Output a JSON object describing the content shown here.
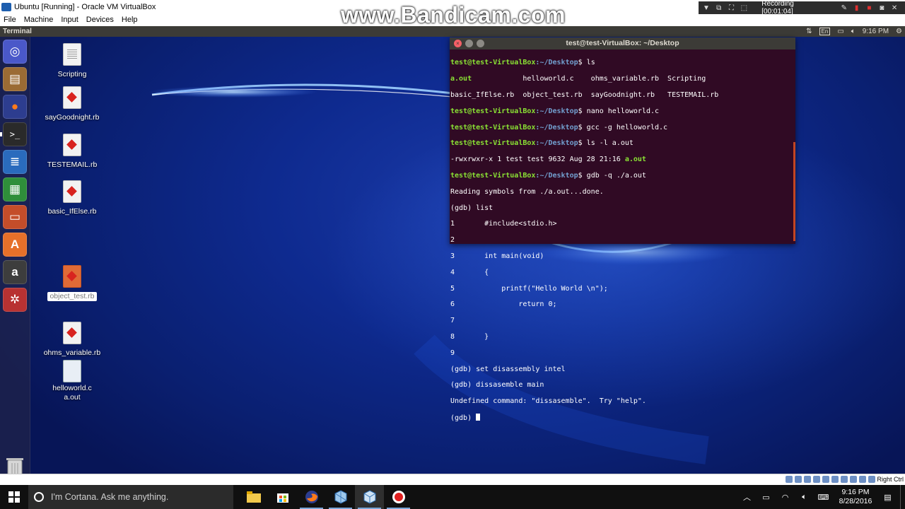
{
  "host": {
    "window_title": "Ubuntu [Running] - Oracle VM VirtualBox",
    "menu": [
      "File",
      "Machine",
      "Input",
      "Devices",
      "Help"
    ],
    "window_buttons": [
      "−",
      "☐",
      "✕"
    ],
    "status_right": "Right Ctrl"
  },
  "overlay": {
    "watermark": "www.Bandicam.com",
    "recording_label": "Recording [00:01:04]"
  },
  "ubuntu": {
    "topbar_app": "Terminal",
    "indicators": {
      "keyboard": "En",
      "time": "9:16 PM"
    },
    "launcher": [
      {
        "name": "ubuntu-dash",
        "glyph": "◎",
        "color": "#4b5bd1"
      },
      {
        "name": "files",
        "glyph": "▤",
        "color": "#b0793c"
      },
      {
        "name": "firefox",
        "glyph": "●",
        "color": "#e66000"
      },
      {
        "name": "terminal",
        "glyph": ">_",
        "color": "#2c2c2c"
      },
      {
        "name": "libreoffice-writer",
        "glyph": "≣",
        "color": "#2a6bbd"
      },
      {
        "name": "libreoffice-calc",
        "glyph": "▦",
        "color": "#2f8f3a"
      },
      {
        "name": "libreoffice-impress",
        "glyph": "▭",
        "color": "#c44d2a"
      },
      {
        "name": "software-center",
        "glyph": "A",
        "color": "#e6702a"
      },
      {
        "name": "amazon",
        "glyph": "a",
        "color": "#3d3d3d"
      },
      {
        "name": "system-settings",
        "glyph": "✲",
        "color": "#c93a3a"
      }
    ],
    "desktop_icons": [
      {
        "label": "Scripting",
        "kind": "doc"
      },
      {
        "label": "sayGoodnight.rb",
        "kind": "rb"
      },
      {
        "label": "TESTEMAIL.rb",
        "kind": "rb"
      },
      {
        "label": "basic_IfElse.rb",
        "kind": "rb"
      },
      {
        "label": "object_test.rb",
        "kind": "rb-selected"
      },
      {
        "label": "ohms_variable.rb",
        "kind": "rb"
      },
      {
        "label": "helloworld.c",
        "kind": "src"
      },
      {
        "label": "a.out",
        "kind": "exec"
      }
    ],
    "terminal": {
      "title": "test@test-VirtualBox: ~/Desktop",
      "prompt_user": "test@test-VirtualBox",
      "prompt_path": ":~/Desktop",
      "lines": {
        "l1_cmd": "$ ls",
        "l2_a": "a.out",
        "l2_b": "            helloworld.c    ohms_variable.rb  Scripting",
        "l3": "basic_IfElse.rb  object_test.rb  sayGoodnight.rb   TESTEMAIL.rb",
        "l4_cmd": "$ nano helloworld.c",
        "l5_cmd": "$ gcc -g helloworld.c",
        "l6_cmd": "$ ls -l a.out",
        "l7_a": "-rwxrwxr-x 1 test test 9632 Aug 28 21:16 ",
        "l7_b": "a.out",
        "l8_cmd": "$ gdb -q ./a.out",
        "l9": "Reading symbols from ./a.out...done.",
        "l10": "(gdb) list",
        "l11": "1       #include<stdio.h>",
        "l12": "2",
        "l13": "3       int main(void)",
        "l14": "4       {",
        "l15": "5           printf(\"Hello World \\n\");",
        "l16": "6               return 0;",
        "l17": "7",
        "l18": "8       }",
        "l19": "9",
        "l20": "(gdb) set disassembly intel",
        "l21": "(gdb) dissasemble main",
        "l22": "Undefined command: \"dissasemble\".  Try \"help\".",
        "l23": "(gdb) "
      }
    }
  },
  "taskbar": {
    "cortana_placeholder": "I'm Cortana. Ask me anything.",
    "apps": [
      "file-explorer",
      "store",
      "firefox",
      "virtualbox-manager",
      "virtualbox-vm",
      "bandicam"
    ],
    "tray_time": "9:16 PM",
    "tray_date": "8/28/2016"
  }
}
